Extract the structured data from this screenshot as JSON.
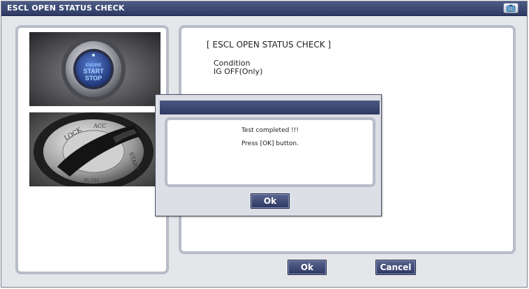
{
  "window": {
    "title": "ESCL OPEN STATUS CHECK",
    "camera_icon": "camera-icon"
  },
  "left_panel": {
    "images": [
      {
        "name": "start-stop-button-photo",
        "button_text_top": "ENGINE",
        "button_text_mid": "START",
        "button_text_bottom": "STOP"
      },
      {
        "name": "ignition-key-photo"
      }
    ]
  },
  "main_panel": {
    "heading": "[ ESCL OPEN STATUS CHECK ]",
    "condition_label": "Condition",
    "condition_value": "IG OFF(Only)"
  },
  "footer": {
    "ok_label": "Ok",
    "cancel_label": "Cancel"
  },
  "dialog": {
    "message_line1": "Test completed !!!",
    "message_line2": "Press [OK] button.",
    "ok_label": "Ok"
  },
  "colors": {
    "titlebar": "#2e3a63",
    "button": "#2c3660",
    "panel_border": "#b8bcc8",
    "window_bg": "#e4e6ea"
  }
}
